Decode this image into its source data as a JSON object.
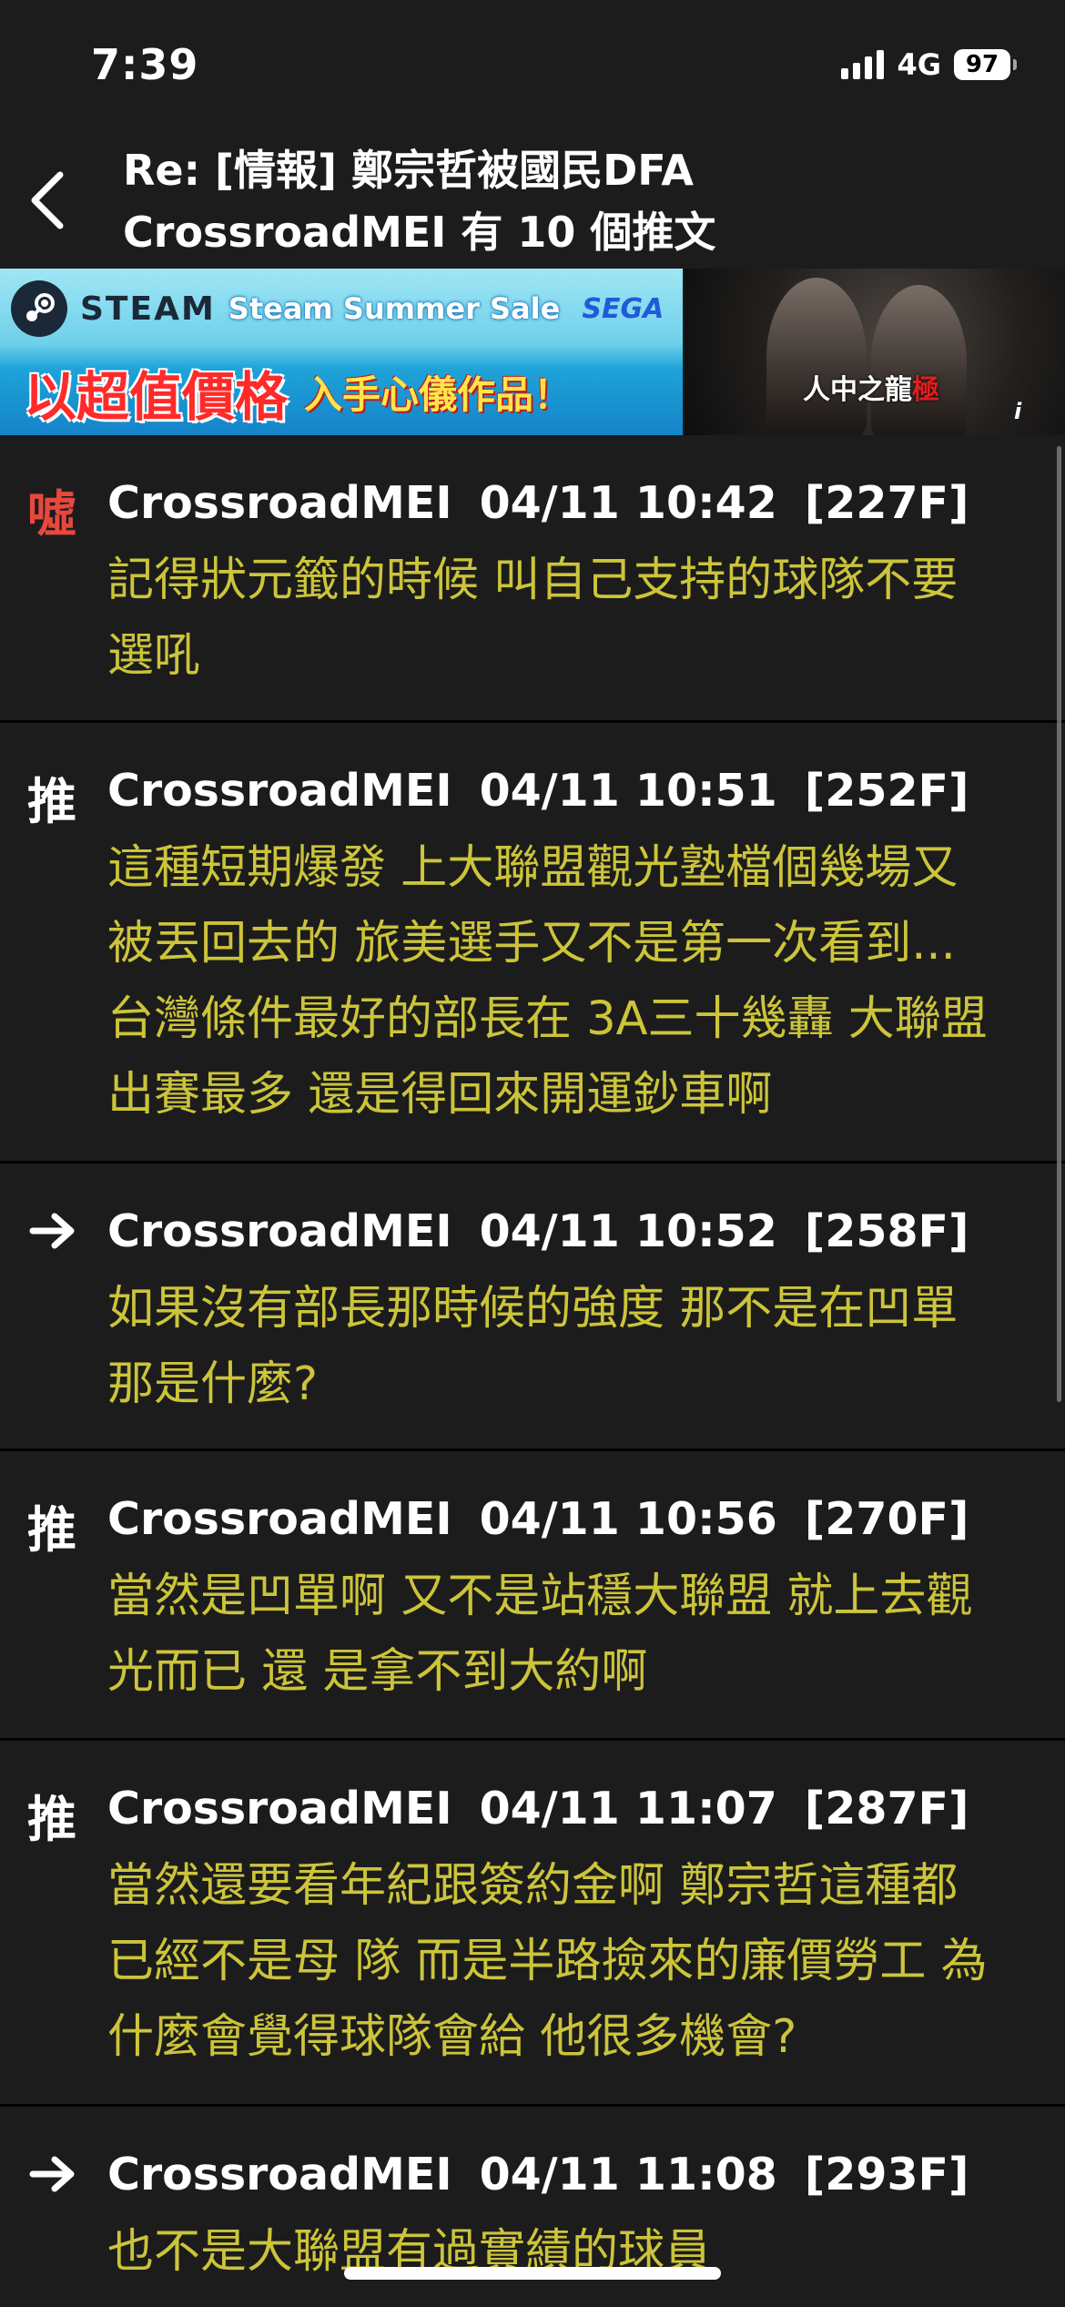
{
  "status": {
    "time": "7:39",
    "network": "4G",
    "battery": "97"
  },
  "nav": {
    "back_icon": "chevron-left-icon",
    "title_line1": "Re: [情報] 鄭宗哲被國民DFA",
    "title_line2": "CrossroadMEI 有 10 個推文"
  },
  "banner": {
    "steam_label": "STEAM",
    "sale_label": "Steam Summer Sale",
    "publisher": "SEGA",
    "promo_big": "以超值價格",
    "promo_small": "入手心儀作品！",
    "game_title_a": "人中之龍",
    "game_title_b": "極",
    "info_label": "i"
  },
  "comments": [
    {
      "type": "噓",
      "kind": "boo",
      "user": "CrossroadMEI",
      "time": "04/11 10:42",
      "floor": "[227F]",
      "lines": [
        "記得狀元籤的時候 叫自己支持的球隊不要",
        "選吼"
      ]
    },
    {
      "type": "推",
      "kind": "push",
      "user": "CrossroadMEI",
      "time": "04/11 10:51",
      "floor": "[252F]",
      "lines": [
        "這種短期爆發 上大聯盟觀光塾檔個幾場又",
        "被丟回去的 旅美選手又不是第一次看到...",
        "台灣條件最好的部長在 3A三十幾轟 大聯盟",
        "出賽最多 還是得回來開運鈔車啊"
      ]
    },
    {
      "type": "→",
      "kind": "arrow",
      "user": "CrossroadMEI",
      "time": "04/11 10:52",
      "floor": "[258F]",
      "lines": [
        "如果沒有部長那時候的強度 那不是在凹單",
        "那是什麼?"
      ]
    },
    {
      "type": "推",
      "kind": "push",
      "user": "CrossroadMEI",
      "time": "04/11 10:56",
      "floor": "[270F]",
      "lines": [
        "當然是凹單啊 又不是站穩大聯盟 就上去觀",
        "光而已 還 是拿不到大約啊"
      ]
    },
    {
      "type": "推",
      "kind": "push",
      "user": "CrossroadMEI",
      "time": "04/11 11:07",
      "floor": "[287F]",
      "lines": [
        "當然還要看年紀跟簽約金啊 鄭宗哲這種都",
        "已經不是母 隊 而是半路撿來的廉價勞工 為",
        "什麼會覺得球隊會給 他很多機會?"
      ]
    },
    {
      "type": "→",
      "kind": "arrow",
      "user": "CrossroadMEI",
      "time": "04/11 11:08",
      "floor": "[293F]",
      "lines": [
        "也不是大聯盟有過實績的球員"
      ]
    }
  ]
}
